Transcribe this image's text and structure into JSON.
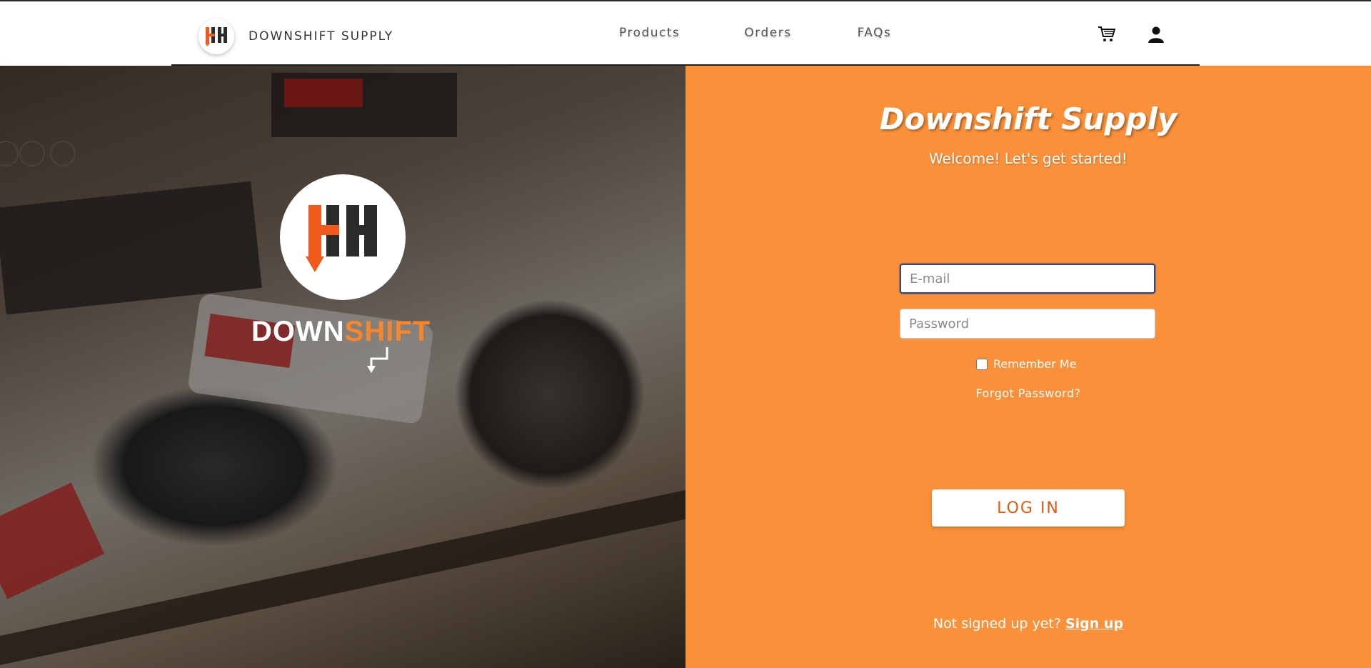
{
  "header": {
    "brand_name": "DOWNSHIFT SUPPLY",
    "nav": [
      "Products",
      "Orders",
      "FAQs"
    ],
    "icons": [
      "cart-icon",
      "user-icon"
    ]
  },
  "hero": {
    "word_main": "DOWN",
    "word_accent": "SHIFT"
  },
  "login": {
    "title": "Downshift Supply",
    "subtitle": "Welcome! Let's get started!",
    "email_placeholder": "E-mail",
    "password_placeholder": "Password",
    "remember_label": "Remember Me",
    "forgot_label": "Forgot Password?",
    "login_button": "LOG IN",
    "signup_prompt": "Not signed up yet?",
    "signup_link": "Sign up"
  },
  "colors": {
    "accent_orange": "#fa9039",
    "button_text": "#e05a12",
    "logo_orange": "#f25a1c",
    "logo_dark": "#2b2b2b"
  }
}
